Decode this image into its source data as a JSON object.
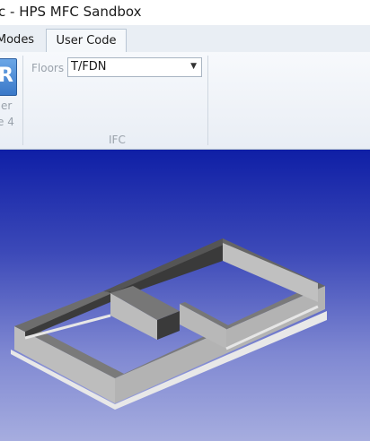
{
  "window": {
    "title": "c - HPS MFC Sandbox"
  },
  "tabs": [
    {
      "label": "Modes",
      "active": false
    },
    {
      "label": "User Code",
      "active": true
    }
  ],
  "ribbon": {
    "button": {
      "icon": "r-icon",
      "label_line1": "er",
      "label_line2": "e 4"
    },
    "floors": {
      "label": "Floors",
      "value": "T/FDN"
    },
    "group_label": "IFC"
  },
  "viewport": {
    "model": "foundation-walls-3d"
  }
}
